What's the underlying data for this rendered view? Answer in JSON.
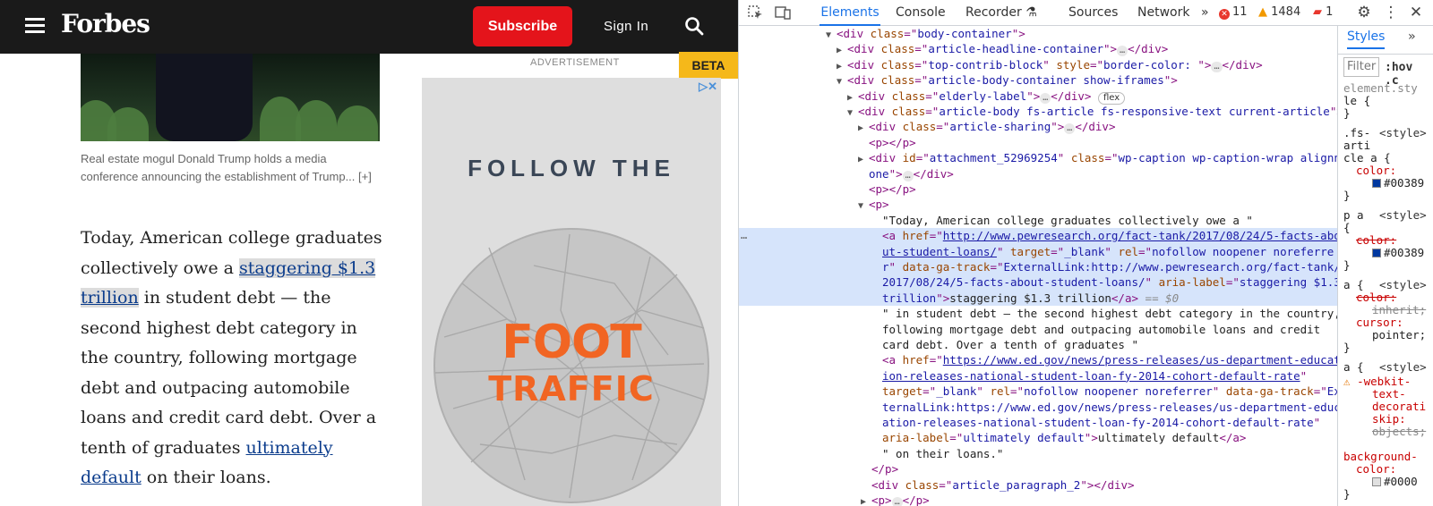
{
  "site": {
    "logo": "Forbes",
    "subscribe": "Subscribe",
    "sign_in": "Sign In",
    "caption": "Real estate mogul Donald Trump holds a media conference announcing the establishment of Trump... [+]",
    "article": {
      "p1": "Today, American college graduates collectively owe a ",
      "link1": "staggering $1.3 trillion",
      "p2": " in student debt — the second highest debt category in the country, following mortgage debt and outpacing automobile loans and credit card debt. Over a tenth of graduates ",
      "link2": "ultimately default",
      "p3": " on their loans."
    },
    "ad_label": "ADVERTISEMENT",
    "beta": "BETA",
    "ad": {
      "choices": "▷✕",
      "follow": "FOLLOW THE",
      "foot": "FOOT",
      "traffic": "TRAFFIC"
    }
  },
  "devtools": {
    "tabs": [
      "Elements",
      "Console",
      "Recorder",
      "Sources",
      "Network"
    ],
    "more_tabs": "»",
    "recorder_icon": "flask-icon",
    "errors": "11",
    "warnings": "1484",
    "issues": "1",
    "colors": {
      "accent": "#1a73e8",
      "tag": "#881280",
      "attr_name": "#994500",
      "attr_value": "#1a1aa6",
      "selected_row": "#d6e4fb",
      "error": "#e8372d",
      "warning": "#f29900"
    },
    "tree": {
      "l1": {
        "tag": "div",
        "attr": "class",
        "val": "body-container"
      },
      "l2": {
        "tag": "div",
        "attr": "class",
        "val": "article-headline-container"
      },
      "l3": {
        "tag": "div",
        "attr": "class",
        "val": "top-contrib-block",
        "attr2": "style",
        "val2": "border-color: "
      },
      "l4": {
        "tag": "div",
        "attr": "class",
        "val": "article-body-container show-iframes"
      },
      "l5": {
        "tag": "div",
        "attr": "class",
        "val": "elderly-label",
        "badge": "flex"
      },
      "l6": {
        "tag": "div",
        "attr": "class",
        "val": "article-body fs-article fs-responsive-text current-article"
      },
      "l7": {
        "tag": "div",
        "attr": "class",
        "val": "article-sharing"
      },
      "l8": "<p></p>",
      "l9": {
        "tag": "div",
        "attr": "id",
        "val": "attachment_52969254",
        "attr2": "class",
        "val2": "wp-caption wp-caption-wrap alignn",
        "cont": "one"
      },
      "l10": "<p></p>",
      "l11": "<p>",
      "t1": "\"Today, American college graduates collectively owe a \"",
      "a1": {
        "href_label": "href",
        "href": "http://www.pewresearch.org/fact-tank/2017/08/24/5-facts-abo",
        "href_cont": "ut-student-loans/",
        "target": "_blank",
        "rel": "nofollow noopener noreferre",
        "rel_cont": "r",
        "ga": "ExternalLink:http://www.pewresearch.org/fact-tank/",
        "ga_cont": "2017/08/24/5-facts-about-student-loans/",
        "aria": "staggering $1.3",
        "aria_cont": "trillion",
        "text": "staggering $1.3 trillion",
        "eq": "== $0"
      },
      "t2a": "\" in student debt — the second highest debt category in the country,",
      "t2b": "following mortgage debt and outpacing automobile loans and credit",
      "t2c": "card debt. Over a tenth of graduates \"",
      "a2": {
        "href": "https://www.ed.gov/news/press-releases/us-department-educat",
        "href_cont": "ion-releases-national-student-loan-fy-2014-cohort-default-rate",
        "target": "_blank",
        "rel": "nofollow noopener noreferrer",
        "ga": "Ex",
        "ga_cont": "ternalLink:https://www.ed.gov/news/press-releases/us-department-educ",
        "ga_cont2": "ation-releases-national-student-loan-fy-2014-cohort-default-rate",
        "aria": "ultimately default",
        "text": "ultimately default"
      },
      "t3": "\" on their loans.\"",
      "close_p": "</p>",
      "l_para2": {
        "tag": "div",
        "attr": "class",
        "val": "article_paragraph_2"
      },
      "l_last": "<p>",
      "ellipsis": "…"
    },
    "styles": {
      "tab": "Styles",
      "more": "»",
      "filter": "Filter",
      "hov": ":hov .c",
      "r1": [
        "element.sty",
        "le {",
        "}"
      ],
      "r2": {
        "sel": [
          ".fs-",
          "arti",
          "cle a {"
        ],
        "src": "<style>",
        "prop": "color:",
        "val": "#00389"
      },
      "r3": {
        "sel": "p a",
        "src": "<style>",
        "brace": "{",
        "prop": "color:",
        "val": "#00389"
      },
      "r4": {
        "sel": "a {",
        "src": "<style>",
        "prop1": "color:",
        "val1": "inherit;",
        "prop2": "cursor:",
        "val2": "pointer;"
      },
      "r5": {
        "sel": "a {",
        "src": "<style>",
        "prop": "-webkit-",
        "p2": "text-",
        "p3": "decorati",
        "p4": "skip:",
        "val": "objects;"
      },
      "r6": {
        "prop": "background-",
        "p2": "color:",
        "val": "#0000"
      }
    }
  }
}
